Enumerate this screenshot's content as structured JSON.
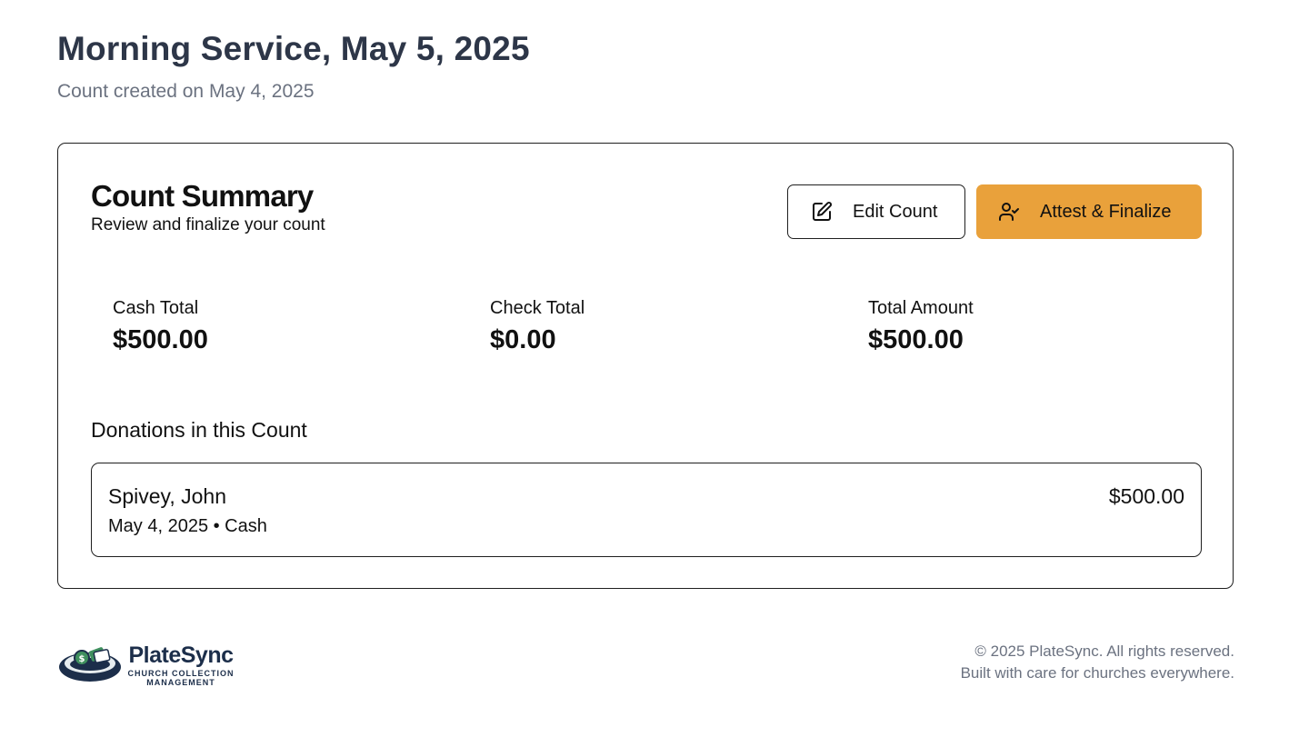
{
  "header": {
    "title": "Morning Service, May 5, 2025",
    "subtitle": "Count created on May 4, 2025"
  },
  "summary": {
    "title": "Count Summary",
    "description": "Review and finalize your count",
    "edit_button": {
      "label": "Edit Count",
      "icon": "edit-pencil-icon"
    },
    "attest_button": {
      "label": "Attest & Finalize",
      "icon": "user-check-icon",
      "color": "#e9a13b"
    },
    "totals": [
      {
        "label": "Cash Total",
        "value": "$500.00"
      },
      {
        "label": "Check Total",
        "value": "$0.00"
      },
      {
        "label": "Total Amount",
        "value": "$500.00"
      }
    ]
  },
  "donations": {
    "heading": "Donations in this Count",
    "items": [
      {
        "name": "Spivey, John",
        "meta": "May 4, 2025 • Cash",
        "amount": "$500.00"
      }
    ]
  },
  "footer": {
    "logo_name": "PlateSync",
    "logo_tagline": "CHURCH COLLECTION MANAGEMENT",
    "copyright": "© 2025 PlateSync. All rights reserved.",
    "tagline": "Built with care for churches everywhere."
  },
  "colors": {
    "title": "#2d3648",
    "muted": "#6b7280",
    "accent": "#e9a13b",
    "brand": "#1c2e4a"
  }
}
